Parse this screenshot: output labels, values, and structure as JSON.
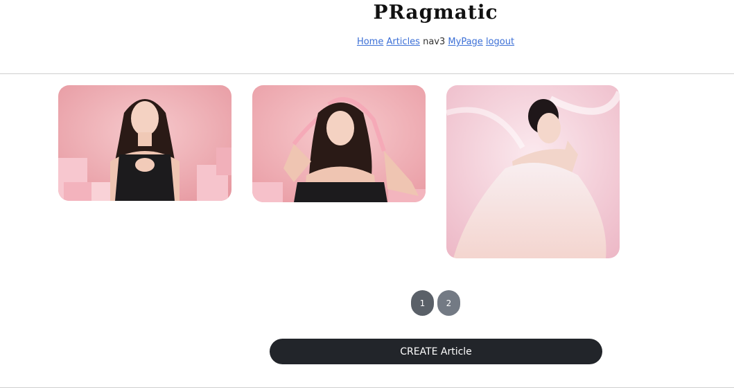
{
  "header": {
    "brand": "PRagmatic",
    "nav": [
      {
        "label": "Home",
        "link": true
      },
      {
        "label": "Articles",
        "link": true
      },
      {
        "label": "nav3",
        "link": false
      },
      {
        "label": "MyPage",
        "link": true
      },
      {
        "label": "logout",
        "link": true
      }
    ]
  },
  "articles": [
    {
      "alt": "woman in black dress with pink gift boxes"
    },
    {
      "alt": "woman tying pink ribbon in hair"
    },
    {
      "alt": "woman in white gown posing on pink background"
    }
  ],
  "pagination": {
    "pages": [
      "1",
      "2"
    ],
    "current": "1"
  },
  "actions": {
    "create_label": "CREATE Article"
  },
  "colors": {
    "link": "#3b6fd6",
    "button_dark": "#22252a",
    "page_active": "#5a6068",
    "page_inactive": "#737a84",
    "photo_pink": "#f0b4b8"
  }
}
